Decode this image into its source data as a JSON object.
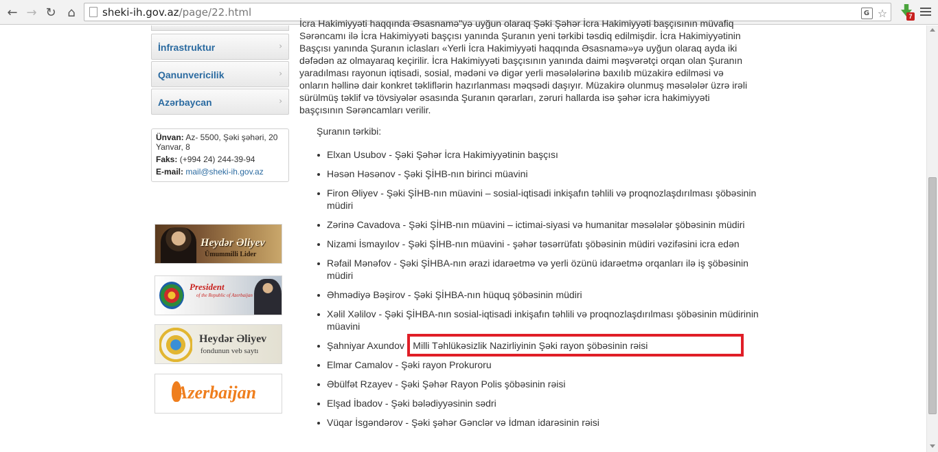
{
  "browser": {
    "url_host": "sheki-ih.gov.az",
    "url_path": "/page/22.html",
    "extension_badge": "7"
  },
  "sidebar": {
    "menu": [
      {
        "label": "İnfrastruktur"
      },
      {
        "label": "Qanunvericilik"
      },
      {
        "label": "Azərbaycan"
      }
    ],
    "contact": {
      "address_label": "Ünvan:",
      "address_value": "Az- 5500, Şəki şəhəri, 20 Yanvar, 8",
      "fax_label": "Faks:",
      "fax_value": "(+994 24) 244-39-94",
      "email_label": "E-mail:",
      "email_value": "mail@sheki-ih.gov.az"
    },
    "banners": [
      {
        "title": "Heydər Əliyev",
        "subtitle": "Ümummilli Lider"
      },
      {
        "title": "President",
        "subtitle": "of the Republic of Azerbaijan"
      },
      {
        "title": "Heydər Əliyev",
        "subtitle": "fondunun veb saytı"
      },
      {
        "title": "Azerbaijan"
      }
    ]
  },
  "content": {
    "intro_lines": [
      "İcra Hakimiyyəti haqqında Əsasnamə\"yə uyğun olaraq Şəki Şəhər İcra Hakimiyyəti başçısının müvafiq",
      "Sərəncamı ilə İcra Hakimiyyəti başçısı yanında Şuranın yeni tərkibi təsdiq edilmişdir. İcra Hakimiyyətinin",
      "Başçısı yanında Şuranın iclasları «Yerli İcra Hakimiyyəti haqqında Əsasnamə»yə uyğun olaraq ayda iki",
      "dəfədən az olmayaraq keçirilir. İcra Hakimiyyəti başçısının yanında daimi məşvərətçi orqan olan Şuranın",
      "yaradılması rayonun iqtisadi, sosial, mədəni və digər yerli məsələlərinə baxılıb müzakirə edilməsi və",
      "onların həllinə dair konkret təkliflərin hazırlanması məqsədi daşıyır. Müzakirə olunmuş məsələlər üzrə irəli",
      "sürülmüş təklif və tövsiyələr əsasında Şuranın qərarları, zəruri hallarda isə şəhər icra hakimiyyəti",
      "başçısının Sərəncamları verilir."
    ],
    "heading": "Şuranın tərkibi:",
    "members": [
      "Elxan Usubov - Şəki Şəhər İcra Hakimiyyətinin başçısı",
      "Həsən Həsənov - Şəki ŞİHB-nın birinci müavini",
      "Firon Əliyev - Şəki ŞİHB-nın müavini – sosial-iqtisadi inkişafın təhlili və proqnozlaşdırılması şöbəsinin müdiri",
      "Zərinə Cavadova - Şəki ŞİHB-nın müavini – ictimai-siyasi və humanitar məsələlər şöbəsinin müdiri",
      "Nizami İsmayılov - Şəki ŞİHB-nın müavini - şəhər təsərrüfatı şöbəsinin müdiri vəzifəsini icra edən",
      "Rəfail Mənəfov - Şəki ŞİHBA-nın ərazi idarəetmə və yerli özünü idarəetmə orqanları ilə iş şöbəsinin müdiri",
      "Əhmədiyə Bəşirov - Şəki ŞİHBA-nın hüquq şöbəsinin müdiri",
      "Xəlil Xəlilov - Şəki ŞİHBA-nın sosial-iqtisadi inkişafın təhlili və proqnozlaşdırılması şöbəsinin müdirinin müavini",
      "Şahniyar Axundov - Milli Təhlükəsizlik Nazirliyinin Şəki rayon şöbəsinin rəisi",
      "Elmar Camalov - Şəki rayon Prokuroru",
      "Əbülfət Rzayev - Şəki Şəhər Rayon Polis şöbəsinin rəisi",
      "Elşad İbadov - Şəki bələdiyyəsinin sədri",
      "Vüqar İsgəndərov - Şəki şəhər Gənclər və İdman idarəsinin rəisi"
    ]
  },
  "colors": {
    "link": "#2a6aa0",
    "highlight": "#e01e27"
  }
}
